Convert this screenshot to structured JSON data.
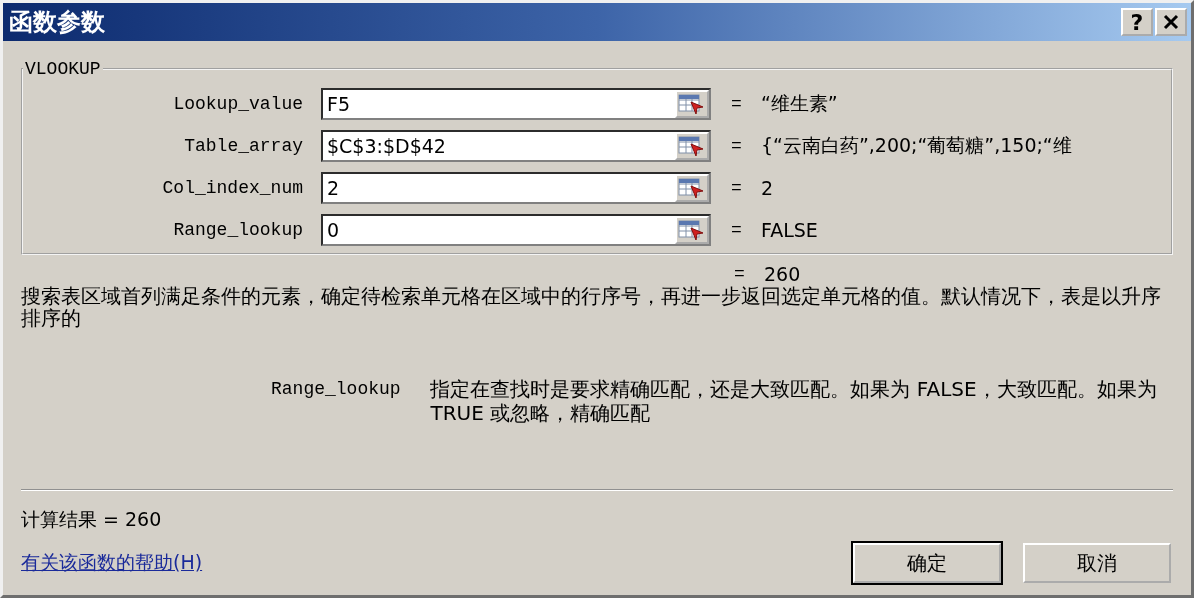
{
  "window": {
    "title": "函数参数",
    "help_button": "?"
  },
  "group": {
    "title": "VLOOKUP",
    "arguments": [
      {
        "label": "Lookup_value",
        "value": "F5",
        "equals": "=",
        "result": "“维生素”"
      },
      {
        "label": "Table_array",
        "value": "$C$3:$D$42",
        "equals": "=",
        "result": "{“云南白药”,200;“葡萄糖”,150;“维"
      },
      {
        "label": "Col_index_num",
        "value": "2",
        "equals": "=",
        "result": "2"
      },
      {
        "label": "Range_lookup",
        "value": "0",
        "equals": "=",
        "result": "FALSE"
      }
    ]
  },
  "formula_result": {
    "equals": "=",
    "value": "260"
  },
  "description": "搜索表区域首列满足条件的元素，确定待检索单元格在区域中的行序号，再进一步返回选定单元格的值。默认情况下，表是以升序排序的",
  "argument_help": {
    "name": "Range_lookup",
    "text": "指定在查找时是要求精确匹配，还是大致匹配。如果为 FALSE，大致匹配。如果为 TRUE 或忽略，精确匹配"
  },
  "calculation_result": "计算结果 = 260",
  "help_link": "有关该函数的帮助(H)",
  "buttons": [
    {
      "label": "确定",
      "default": true
    },
    {
      "label": "取消",
      "default": false
    }
  ]
}
